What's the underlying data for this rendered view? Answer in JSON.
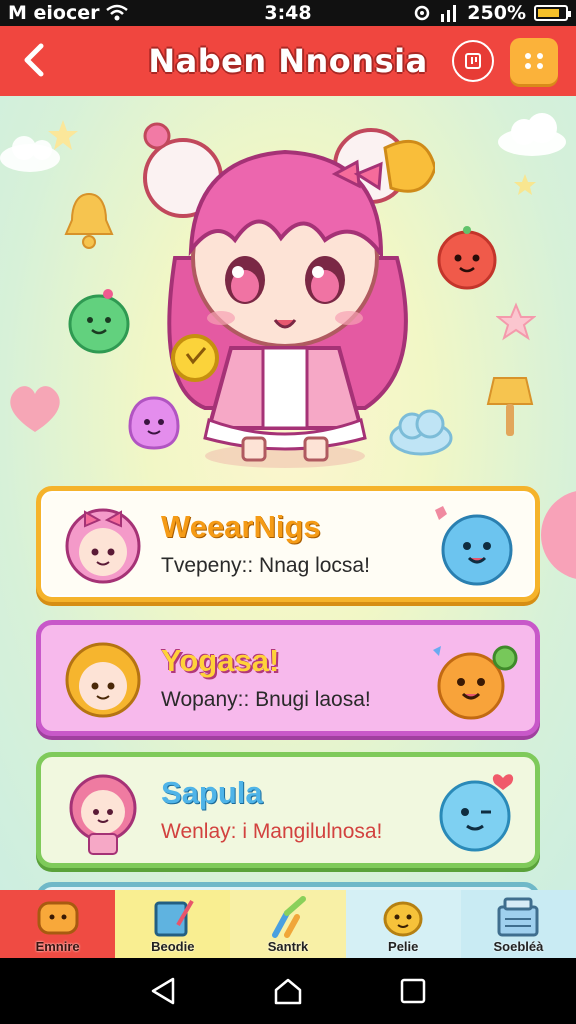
{
  "status": {
    "carrier": "M eiocer",
    "time": "3:48",
    "battery": "250%"
  },
  "header": {
    "title": "Naben Nnonsia"
  },
  "cards": [
    {
      "name": "WeearNigs",
      "subtitle": "Tvepeny:: Nnag locsa!",
      "accent": "#f5b32b"
    },
    {
      "name": "Yogasa!",
      "subtitle": "Wopany:: Bnugi laosa!",
      "accent": "#c858c9"
    },
    {
      "name": "Sapula",
      "subtitle": "Wenlay: i Mangilulnosa!",
      "accent": "#7fca5a"
    }
  ],
  "tabs": [
    {
      "label": "Emnire",
      "icon": "smile-blob-icon"
    },
    {
      "label": "Beodie",
      "icon": "tablet-pen-icon"
    },
    {
      "label": "Santrk",
      "icon": "paint-brush-icon"
    },
    {
      "label": "Pelie",
      "icon": "puppy-face-icon"
    },
    {
      "label": "Soebléà",
      "icon": "shop-register-icon"
    }
  ],
  "colors": {
    "header": "#f0463f",
    "menu_button": "#fbb23a",
    "active_tab": "#ef4b43"
  }
}
